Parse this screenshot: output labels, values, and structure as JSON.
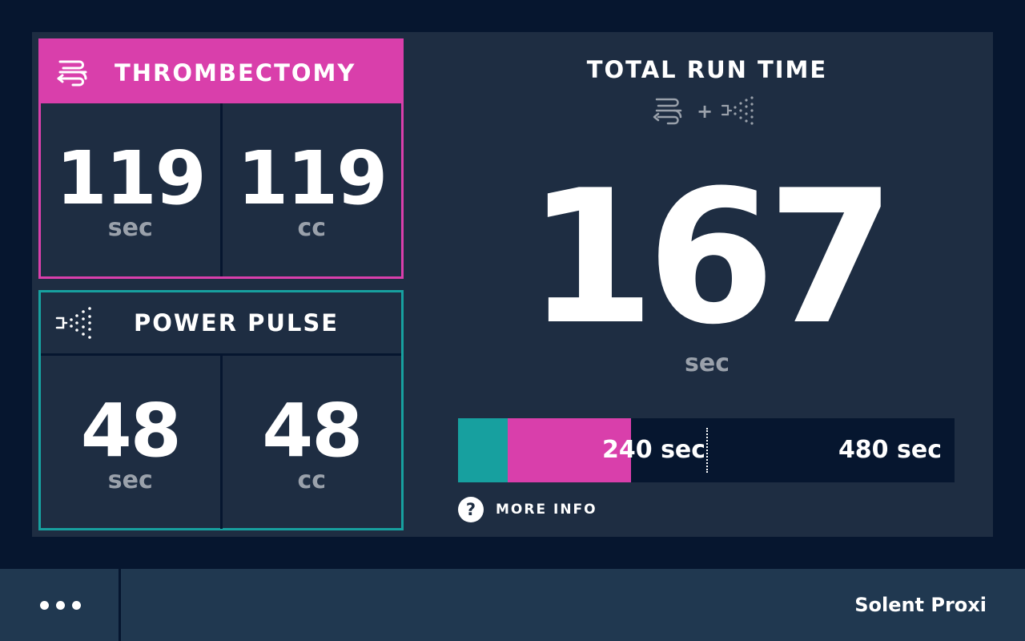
{
  "thrombectomy": {
    "title": "THROMBECTOMY",
    "icon": "thrombectomy-icon",
    "color": "#d93fab",
    "time_value": "119",
    "time_unit": "sec",
    "volume_value": "119",
    "volume_unit": "cc"
  },
  "power_pulse": {
    "title": "POWER PULSE",
    "icon": "power-pulse-icon",
    "color": "#17a09f",
    "time_value": "48",
    "time_unit": "sec",
    "volume_value": "48",
    "volume_unit": "cc"
  },
  "total": {
    "title": "TOTAL RUN TIME",
    "plus": "+",
    "value": "167",
    "unit": "sec"
  },
  "progress": {
    "power_pulse_fraction": 0.1,
    "thrombectomy_fraction": 0.2484,
    "marker_fraction": 0.5,
    "mid_label": "240 sec",
    "max_label": "480 sec"
  },
  "more_info": {
    "icon": "help-icon",
    "icon_glyph": "?",
    "label": "MORE INFO"
  },
  "footer": {
    "menu_icon": "more-dots-icon",
    "device_name": "Solent Proxi"
  },
  "colors": {
    "background": "#06162f",
    "panel": "#1e2d42",
    "footer": "#203850",
    "muted_text": "#9aa1ab"
  }
}
